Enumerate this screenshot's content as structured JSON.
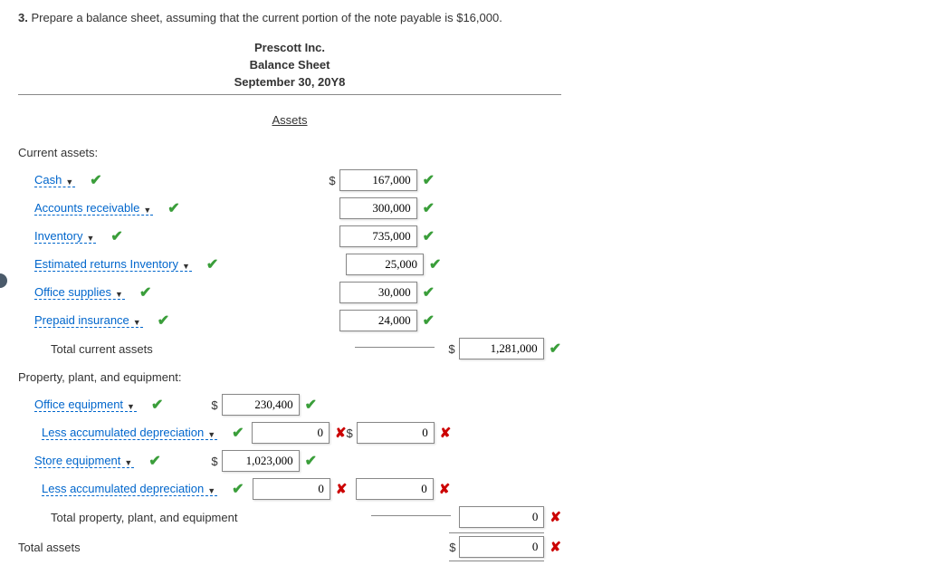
{
  "question": {
    "number": "3.",
    "text": "Prepare a balance sheet, assuming that the current portion of the note payable is $16,000."
  },
  "header": {
    "company": "Prescott Inc.",
    "title": "Balance Sheet",
    "date": "September 30, 20Y8"
  },
  "sections": {
    "assets_heading": "Assets",
    "current_assets_label": "Current assets:",
    "total_current_label": "Total current assets",
    "ppe_label": "Property, plant, and equipment:",
    "total_ppe_label": "Total property, plant, and equipment",
    "total_assets_label": "Total assets"
  },
  "current_assets": [
    {
      "name": "Cash",
      "value": "167,000",
      "mark": "check"
    },
    {
      "name": "Accounts receivable",
      "value": "300,000",
      "mark": "check"
    },
    {
      "name": "Inventory",
      "value": "735,000",
      "mark": "check"
    },
    {
      "name": "Estimated returns Inventory",
      "value": "25,000",
      "mark": "check"
    },
    {
      "name": "Office supplies",
      "value": "30,000",
      "mark": "check"
    },
    {
      "name": "Prepaid insurance",
      "value": "24,000",
      "mark": "check"
    }
  ],
  "total_current_value": "1,281,000",
  "ppe": {
    "office_eq": {
      "name": "Office equipment",
      "value": "230,400",
      "mark": "check"
    },
    "office_dep": {
      "name": "Less accumulated depreciation",
      "v1": "0",
      "m1": "x",
      "v2": "0",
      "m2": "x"
    },
    "store_eq": {
      "name": "Store equipment",
      "value": "1,023,000",
      "mark": "check"
    },
    "store_dep": {
      "name": "Less accumulated depreciation",
      "v1": "0",
      "m1": "x",
      "v2": "0",
      "m2": "x"
    }
  },
  "total_ppe_value": "0",
  "total_assets_value": "0",
  "chart_data": {
    "type": "table",
    "title": "Prescott Inc. Balance Sheet — September 30, 20Y8 — Assets",
    "current_assets": {
      "Cash": 167000,
      "Accounts receivable": 300000,
      "Inventory": 735000,
      "Estimated returns Inventory": 25000,
      "Office supplies": 30000,
      "Prepaid insurance": 24000,
      "Total current assets": 1281000
    },
    "property_plant_equipment": {
      "Office equipment": 230400,
      "Less accumulated depreciation (office)": 0,
      "Office equipment net": 0,
      "Store equipment": 1023000,
      "Less accumulated depreciation (store)": 0,
      "Store equipment net": 0,
      "Total property, plant, and equipment": 0
    },
    "Total assets": 0
  }
}
